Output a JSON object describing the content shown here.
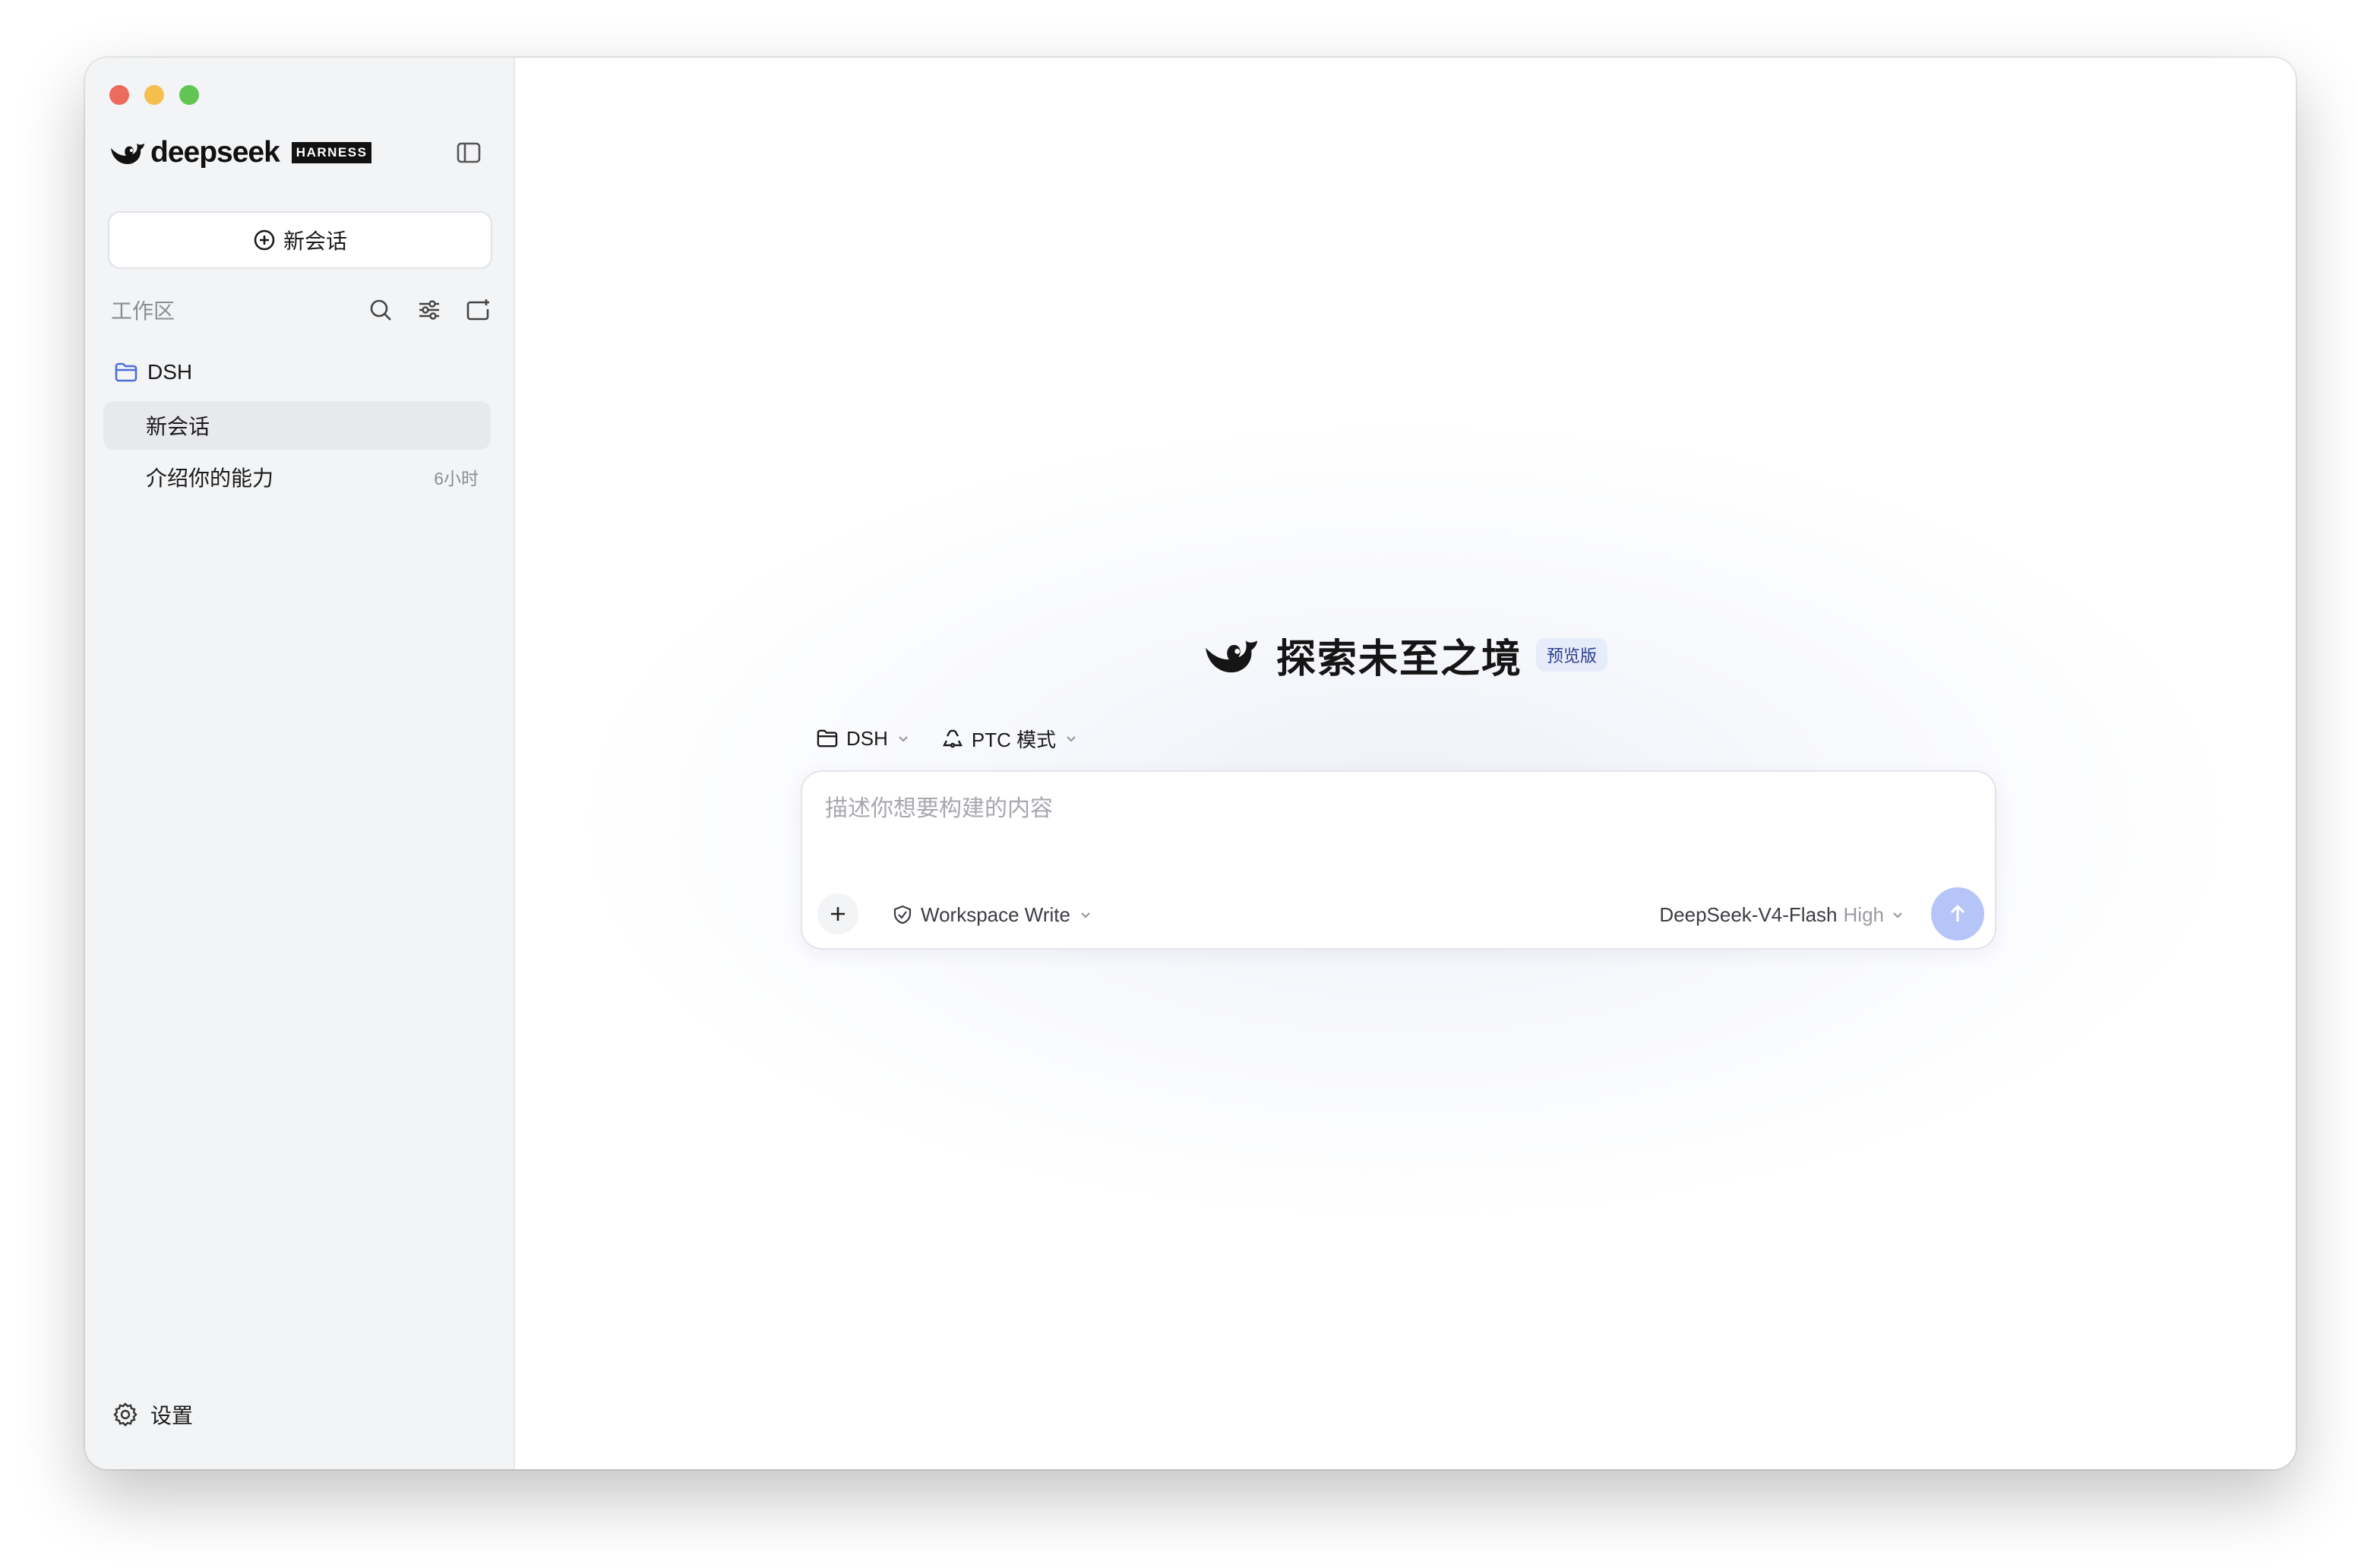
{
  "window": {
    "traffic_lights": [
      "close",
      "minimize",
      "zoom"
    ]
  },
  "sidebar": {
    "brand": {
      "wordmark": "deepseek",
      "badge": "HARNESS",
      "icon": "whale-logo-icon"
    },
    "new_chat_label": "新会话",
    "workspace": {
      "label": "工作区",
      "actions": [
        "search-icon",
        "filter-icon",
        "new-folder-icon"
      ]
    },
    "folder": {
      "name": "DSH",
      "icon": "folder-icon"
    },
    "conversations": [
      {
        "title": "新会话",
        "time": "",
        "active": true
      },
      {
        "title": "介绍你的能力",
        "time": "6小时",
        "active": false
      }
    ],
    "settings_label": "设置"
  },
  "main": {
    "hero": {
      "title": "探索未至之境",
      "badge": "预览版"
    },
    "selectors": {
      "workspace": "DSH",
      "mode": "PTC 模式"
    },
    "composer": {
      "placeholder": "描述你想要构建的内容",
      "value": "",
      "permission": "Workspace Write",
      "model": "DeepSeek-V4-Flash",
      "level": "High"
    }
  },
  "colors": {
    "sidebar_bg": "#f3f4f6",
    "accent_send": "#b6c5f8",
    "folder_blue": "#4a6fd8",
    "badge_bg": "#e7ecfb"
  }
}
